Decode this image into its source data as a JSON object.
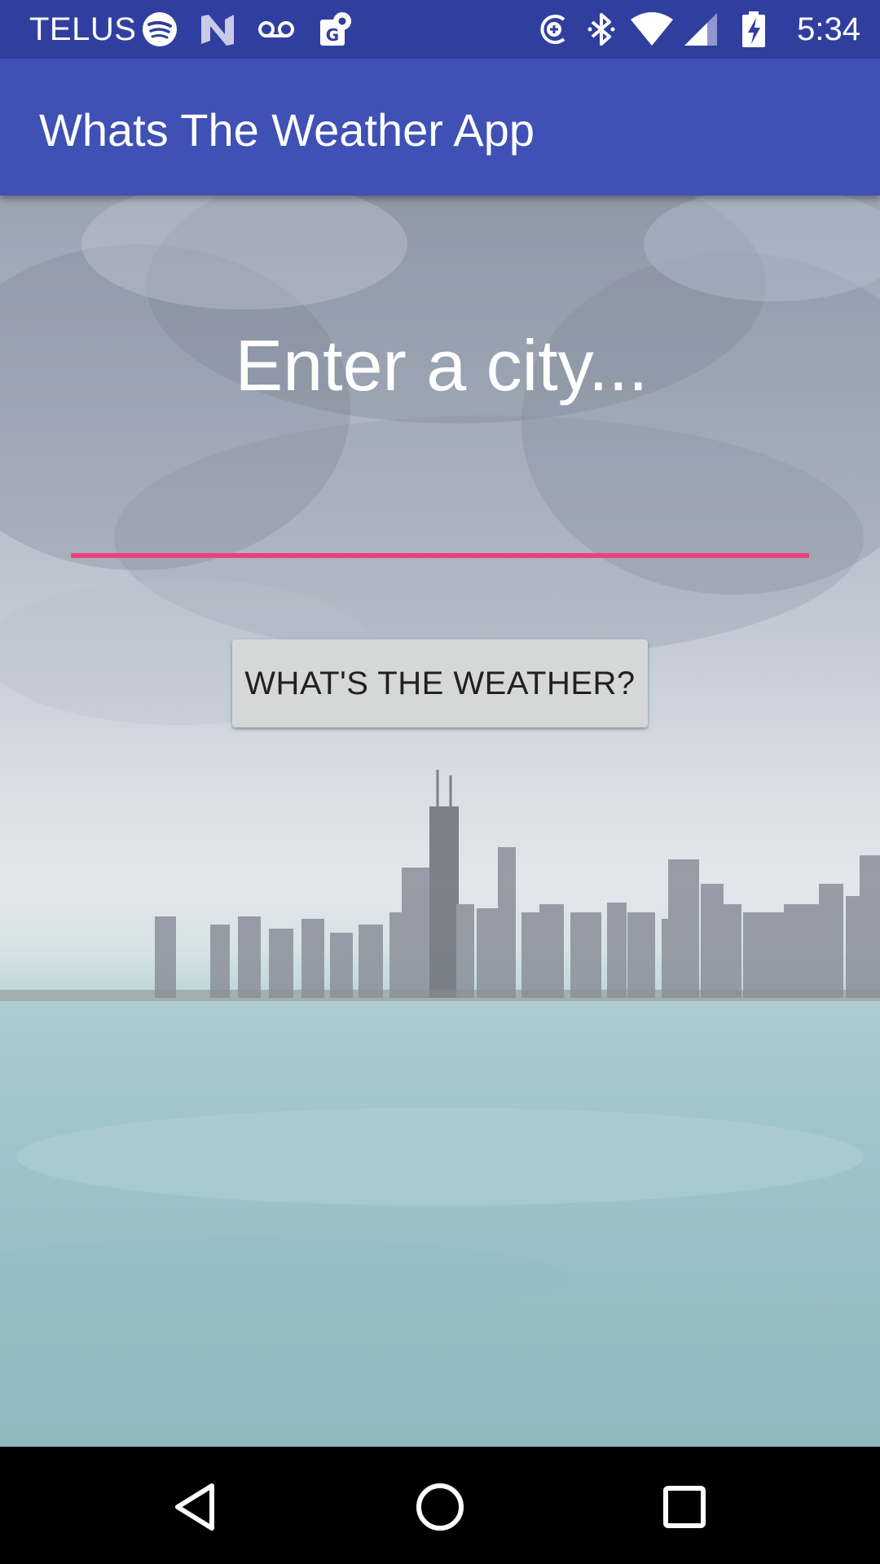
{
  "status_bar": {
    "carrier": "TELUS",
    "time": "5:34",
    "icons": [
      "spotify-icon",
      "n-icon",
      "voicemail-icon",
      "maps-icon",
      "sync-icon",
      "bluetooth-icon",
      "wifi-icon",
      "signal-icon",
      "battery-charging-icon"
    ]
  },
  "app_bar": {
    "title": "Whats The Weather App"
  },
  "main": {
    "city_input": {
      "value": "",
      "placeholder": "Enter a city..."
    },
    "weather_button": {
      "label": "WHAT'S THE WEATHER?"
    }
  },
  "nav_bar": {
    "icons": [
      "back-icon",
      "home-icon",
      "recents-icon"
    ]
  },
  "colors": {
    "status_bar": "#303f9f",
    "app_bar": "#3f51b5",
    "accent": "#e9437a",
    "button": "#d6d7d7"
  }
}
